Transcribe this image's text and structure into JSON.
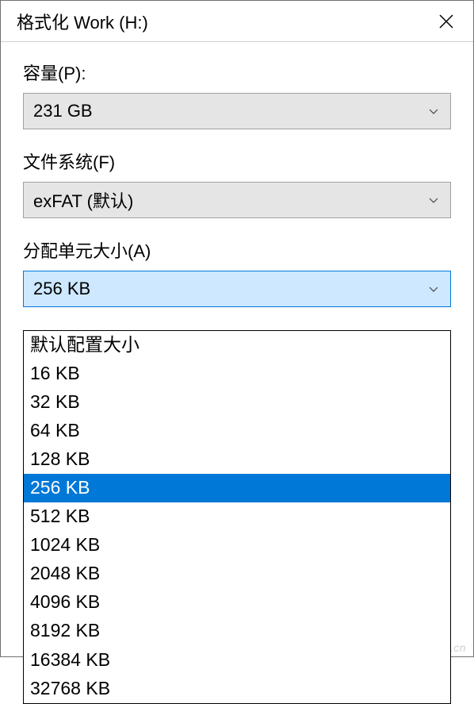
{
  "titlebar": {
    "title": "格式化 Work (H:)"
  },
  "capacity": {
    "label": "容量(P):",
    "value": "231 GB"
  },
  "filesystem": {
    "label": "文件系统(F)",
    "value": "exFAT (默认)"
  },
  "allocation": {
    "label": "分配单元大小(A)",
    "value": "256 KB",
    "options": [
      "默认配置大小",
      "16 KB",
      "32 KB",
      "64 KB",
      "128 KB",
      "256 KB",
      "512 KB",
      "1024 KB",
      "2048 KB",
      "4096 KB",
      "8192 KB",
      "16384 KB",
      "32768 KB"
    ],
    "selected_index": 5
  },
  "watermark": "www.cfan.com.cn"
}
